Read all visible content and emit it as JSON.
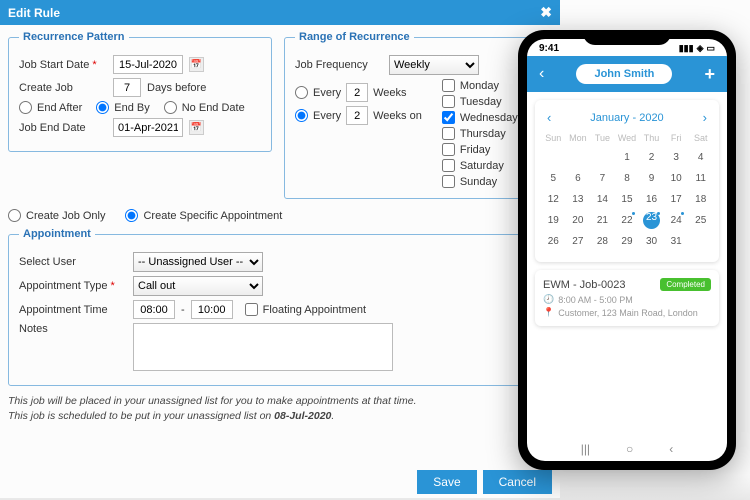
{
  "dialog": {
    "title": "Edit Rule",
    "recurrence": {
      "legend": "Recurrence Pattern",
      "start_label": "Job Start Date",
      "start_value": "15-Jul-2020",
      "create_label": "Create Job",
      "create_value": "7",
      "create_suffix": "Days before",
      "end_after": "End After",
      "end_by": "End By",
      "no_end": "No End Date",
      "end_label": "Job End Date",
      "end_value": "01-Apr-2021"
    },
    "range": {
      "legend": "Range of Recurrence",
      "freq_label": "Job Frequency",
      "freq_value": "Weekly",
      "every_a": "Every",
      "every_a_val": "2",
      "every_a_unit": "Weeks",
      "every_b": "Every",
      "every_b_val": "2",
      "every_b_unit": "Weeks on",
      "days": [
        "Monday",
        "Tuesday",
        "Wednesday",
        "Thursday",
        "Friday",
        "Saturday",
        "Sunday"
      ]
    },
    "mode": {
      "job_only": "Create Job Only",
      "specific": "Create Specific Appointment"
    },
    "appt": {
      "legend": "Appointment",
      "user_label": "Select User",
      "user_value": "-- Unassigned User --",
      "type_label": "Appointment Type",
      "type_value": "Call out",
      "time_label": "Appointment Time",
      "time_from": "08:00",
      "time_to": "10:00",
      "floating": "Floating Appointment",
      "notes_label": "Notes"
    },
    "footnote1": "This job will be placed in your unassigned list for you to make appointments at that time.",
    "footnote2a": "This job is scheduled to be put in your unassigned list on ",
    "footnote2b": "08-Jul-2020",
    "save": "Save",
    "cancel": "Cancel"
  },
  "phone": {
    "time": "9:41",
    "user": "John Smith",
    "cal_title": "January - 2020",
    "dow": [
      "Sun",
      "Mon",
      "Tue",
      "Wed",
      "Thu",
      "Fri",
      "Sat"
    ],
    "job": {
      "title": "EWM - Job-0023",
      "status": "Completed",
      "time": "8:00 AM - 5:00 PM",
      "addr": "Customer, 123 Main Road, London"
    }
  }
}
